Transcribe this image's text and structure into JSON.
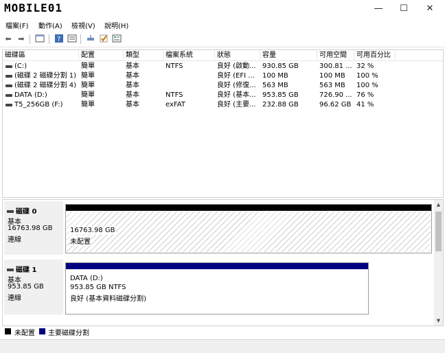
{
  "app": {
    "logo_text": "MOBILE01"
  },
  "window_controls": {
    "minimize": "—",
    "maximize": "☐",
    "close": "✕"
  },
  "menu": [
    "檔案(F)",
    "動作(A)",
    "檢視(V)",
    "說明(H)"
  ],
  "volume_columns": [
    "磁碟區",
    "配置",
    "類型",
    "檔案系統",
    "狀態",
    "容量",
    "可用空間",
    "可用百分比"
  ],
  "volumes": [
    [
      "(C:)",
      "簡單",
      "基本",
      "NTFS",
      "良好 (啟動...",
      "930.85 GB",
      "300.81 ...",
      "32 %"
    ],
    [
      "(磁碟 2 磁碟分割 1)",
      "簡單",
      "基本",
      "",
      "良好 (EFI ...",
      "100 MB",
      "100 MB",
      "100 %"
    ],
    [
      "(磁碟 2 磁碟分割 4)",
      "簡單",
      "基本",
      "",
      "良好 (修復...",
      "563 MB",
      "563 MB",
      "100 %"
    ],
    [
      "DATA (D:)",
      "簡單",
      "基本",
      "NTFS",
      "良好 (基本...",
      "953.85 GB",
      "726.90 ...",
      "76 %"
    ],
    [
      "T5_256GB (F:)",
      "簡單",
      "基本",
      "exFAT",
      "良好 (主要...",
      "232.88 GB",
      "96.62 GB",
      "41 %"
    ]
  ],
  "disks": [
    {
      "name": "磁碟 0",
      "type": "基本",
      "size": "16763.98 GB",
      "state": "連線",
      "partition": {
        "size": "16763.98 GB",
        "status": "未配置"
      }
    },
    {
      "name": "磁碟 1",
      "type": "基本",
      "size": "953.85 GB",
      "state": "連線",
      "partition": {
        "label": "DATA  (D:)",
        "size_fs": "953.85 GB NTFS",
        "status": "良好 (基本資料磁碟分割)"
      }
    }
  ],
  "legend": {
    "unallocated": "未配置",
    "primary": "主要磁碟分割"
  },
  "colors": {
    "unallocated": "#000000",
    "primary": "#000080"
  }
}
